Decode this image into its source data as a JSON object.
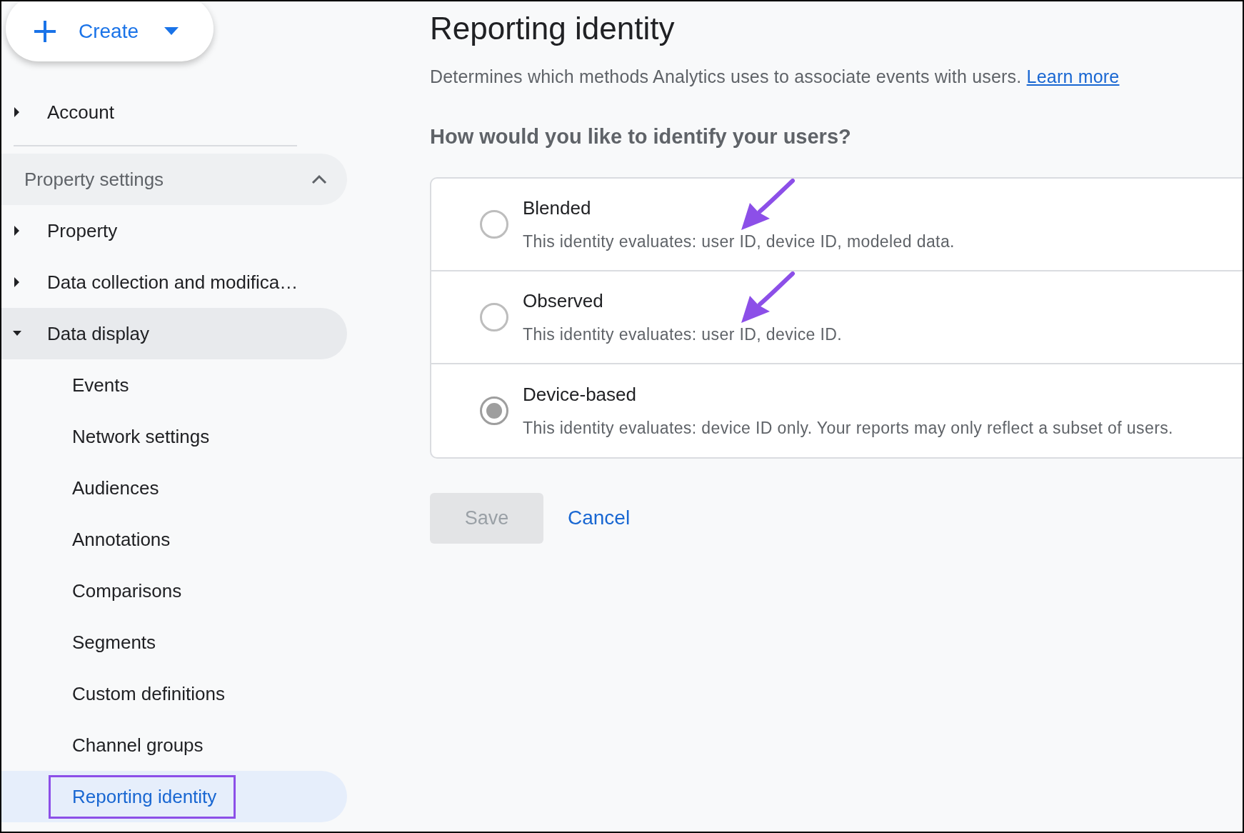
{
  "sidebar": {
    "create_button": {
      "label": "Create"
    },
    "account": {
      "label": "Account",
      "expanded": false
    },
    "property_settings": {
      "label": "Property settings",
      "expanded": true,
      "items": [
        {
          "label": "Property",
          "expanded": false
        },
        {
          "label": "Data collection and modifica…",
          "expanded": false
        },
        {
          "label": "Data display",
          "expanded": true,
          "children": [
            {
              "label": "Events",
              "selected": false,
              "highlighted": false
            },
            {
              "label": "Network settings",
              "selected": false,
              "highlighted": false
            },
            {
              "label": "Audiences",
              "selected": false,
              "highlighted": false
            },
            {
              "label": "Annotations",
              "selected": false,
              "highlighted": false
            },
            {
              "label": "Comparisons",
              "selected": false,
              "highlighted": false
            },
            {
              "label": "Segments",
              "selected": false,
              "highlighted": false
            },
            {
              "label": "Custom definitions",
              "selected": false,
              "highlighted": false
            },
            {
              "label": "Channel groups",
              "selected": false,
              "highlighted": false
            },
            {
              "label": "Reporting identity",
              "selected": true,
              "highlighted": true
            }
          ]
        }
      ]
    }
  },
  "main": {
    "title": "Reporting identity",
    "description": "Determines which methods Analytics uses to associate events with users.",
    "learn_more_link": "Learn more",
    "question": "How would you like to identify your users?",
    "options": [
      {
        "label": "Blended",
        "description": "This identity evaluates: user ID, device ID, modeled data.",
        "selected": false,
        "annotated": true
      },
      {
        "label": "Observed",
        "description": "This identity evaluates: user ID, device ID.",
        "selected": false,
        "annotated": true
      },
      {
        "label": "Device-based",
        "description": "This identity evaluates: device ID only. Your reports may only reflect a subset of users.",
        "selected": true,
        "annotated": false
      }
    ],
    "save_button": {
      "label": "Save",
      "disabled": true
    },
    "cancel_button": {
      "label": "Cancel"
    }
  }
}
